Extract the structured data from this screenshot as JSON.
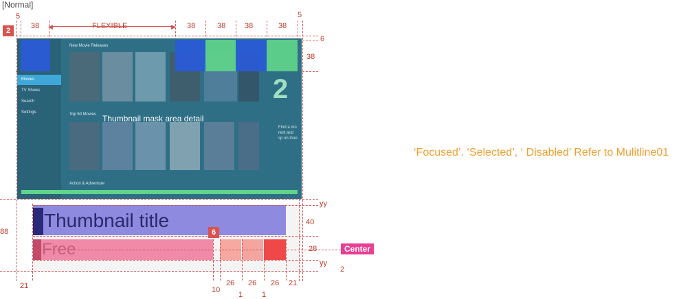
{
  "state_tag": "[Normal]",
  "badges": {
    "first": "2",
    "second": "6"
  },
  "top_dimensions": {
    "left_margin": "5",
    "right_margin": "5",
    "col1": "38",
    "flexible": "FLEXIBLE",
    "col_a": "38",
    "col_b": "38",
    "col_c": "38",
    "col_d": "38",
    "top_gap": "6",
    "row_height": "38"
  },
  "screen": {
    "section1": "New Movie Releases",
    "section2": "Top 50 Movies",
    "section3": "Action & Adventure",
    "menu": [
      "Movies",
      "TV Shows",
      "Search",
      "Settings"
    ],
    "mask_caption": "Thumbnail mask area detail",
    "side_text": "Find a mo rent and sp on Goo",
    "big_number": "2"
  },
  "text_area": {
    "title": "Thumbnail title",
    "subtitle": "Free",
    "center_tag": "Center"
  },
  "bottom_dimensions": {
    "left_height": "88",
    "yy_top": "yy",
    "title_height": "40",
    "sub_height": "28",
    "yy_bottom": "yy",
    "bottom_gap": "2",
    "left_inset": "21",
    "gap10": "10",
    "w26a": "26",
    "g1a": "1",
    "w26b": "26",
    "g1b": "1",
    "w26c": "26",
    "right_inset": "21"
  },
  "note": "‘Focused’. ‘Selected’, ‘ Disabled’  Refer to Mulitline01",
  "colors": {
    "screen_bg": "#2f6f86",
    "blue_box": "#2a5ad8",
    "green_box": "#5fd48a",
    "title_bar": "#8d8ae0",
    "title_mark": "#2a2a7a",
    "sub_bar": "#f08aa8",
    "accent_red": "#d9534f",
    "note_orange": "#f0a030",
    "center_tag": "#ea3d94"
  }
}
